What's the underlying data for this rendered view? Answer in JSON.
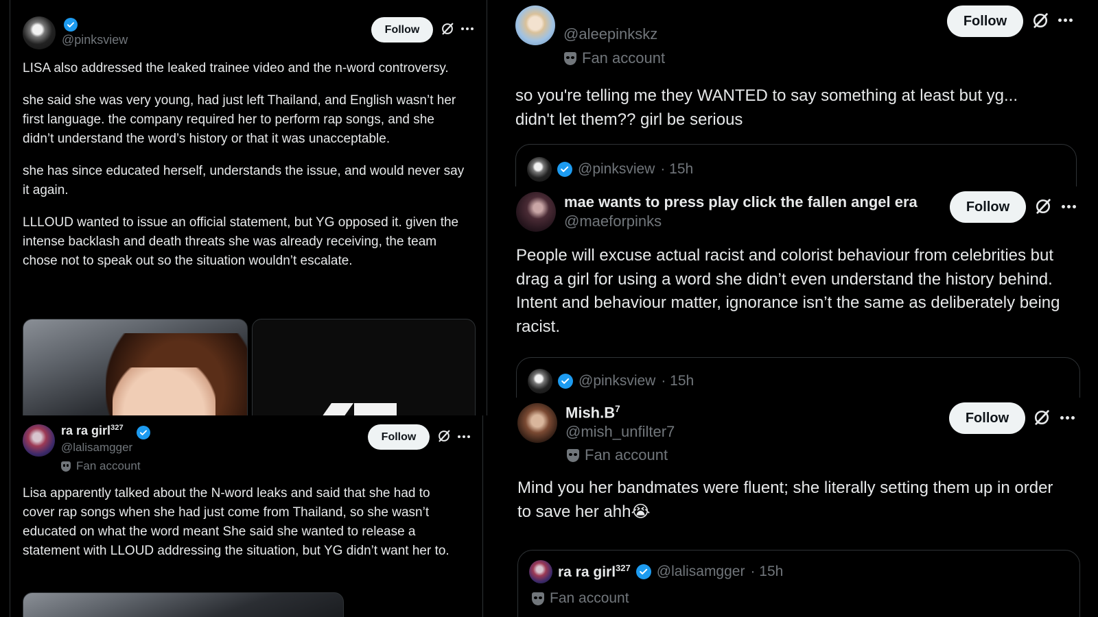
{
  "common": {
    "follow_label": "Follow"
  },
  "left_top": {
    "handle": "@pinksview",
    "paragraphs": [
      "LISA also addressed the leaked trainee video and the n-word controversy.",
      "she said she was very young, had just left Thailand, and English wasn’t her first language. the company required her to perform rap songs, and she didn’t understand the word’s history or that it was unacceptable.",
      "she has since educated herself, understands the issue, and would never say it again.",
      "LLLOUD wanted to issue an official statement, but YG opposed it. given the intense backlash and death threats she was already receiving, the team chose not to speak out so the situation wouldn’t escalate."
    ]
  },
  "left_bottom": {
    "name": "ra ra girl",
    "name_sup": "327",
    "handle": "@lalisamgger",
    "badge": "Fan account",
    "body": "Lisa apparently talked about the N-word leaks and said that she had to cover rap songs when she had just come from Thailand, so she wasn’t educated on what the word meant She said she wanted to release a statement with LLOUD addressing the situation, but YG didn’t want her to."
  },
  "right_1": {
    "handle": "@aleepinkskz",
    "badge": "Fan account",
    "body": "so you're telling me they WANTED to say something at least but yg... didn't let them?? girl be serious",
    "quote_handle": "@pinksview",
    "quote_time": "· 15h"
  },
  "right_2": {
    "name": "mae wants to press play click the fallen angel era",
    "handle": "@maeforpinks",
    "body": "People will excuse actual racist and colorist behaviour from celebrities but drag a girl for using a word she didn’t even understand the history behind. Intent and behaviour matter, ignorance isn’t the same as deliberately being racist.",
    "quote_handle": "@pinksview",
    "quote_time": "· 15h"
  },
  "right_3": {
    "name": "Mish.B",
    "name_sup": "7",
    "handle": "@mish_unfilter7",
    "badge": "Fan account",
    "body": "Mind you her bandmates were fluent; she literally setting them up in order to save her ahh😭",
    "quote_name": "ra ra girl",
    "quote_name_sup": "327",
    "quote_handle": "@lalisamgger",
    "quote_time": "· 15h",
    "quote_badge": "Fan account"
  },
  "icons": {
    "verified": "verified-badge-icon",
    "grok": "grok-icon",
    "more": "more-icon",
    "mask": "fan-account-mask-icon"
  },
  "colors": {
    "accent": "#1d9bf0",
    "muted": "#71767b",
    "text": "#e7e9ea",
    "border": "#2f3336"
  }
}
